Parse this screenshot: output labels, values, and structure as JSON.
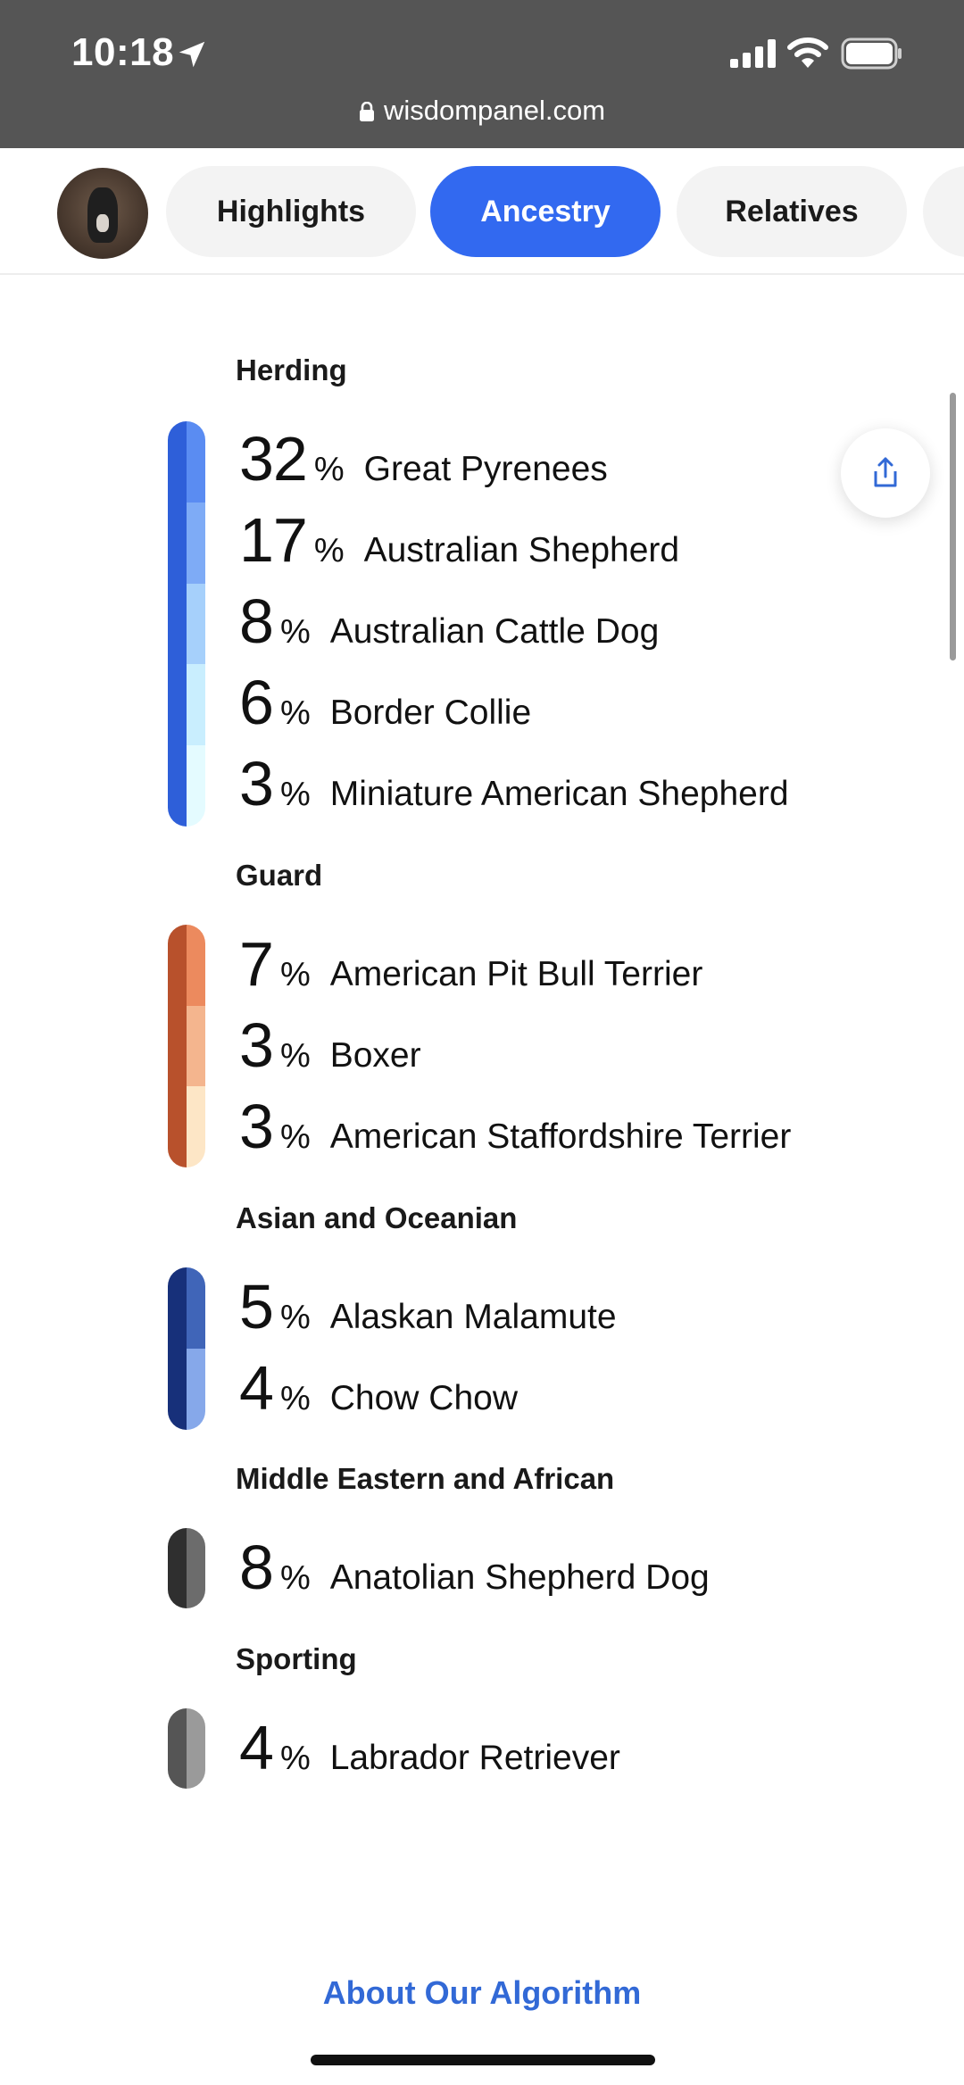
{
  "status_bar": {
    "time": "10:18",
    "url": "wisdompanel.com",
    "icons": [
      "location-arrow-icon",
      "signal-icon",
      "wifi-icon",
      "battery-icon",
      "lock-icon"
    ]
  },
  "nav": {
    "tabs": [
      {
        "label": "Highlights",
        "active": false
      },
      {
        "label": "Ancestry",
        "active": true
      },
      {
        "label": "Relatives",
        "active": false
      }
    ]
  },
  "groups": [
    {
      "title": "Herding",
      "colors": {
        "dark": "#2e5fd9",
        "segments": [
          "#5a8cf2",
          "#7eabf6",
          "#a6d0fb",
          "#c9eefe",
          "#e4fbff"
        ]
      },
      "breeds": [
        {
          "percent": "32",
          "name": "Great Pyrenees"
        },
        {
          "percent": "17",
          "name": "Australian Shepherd"
        },
        {
          "percent": "8",
          "name": "Australian Cattle Dog"
        },
        {
          "percent": "6",
          "name": "Border Collie"
        },
        {
          "percent": "3",
          "name": "Miniature American Shepherd"
        }
      ]
    },
    {
      "title": "Guard",
      "colors": {
        "dark": "#b8512c",
        "segments": [
          "#ec8a5e",
          "#f4b58e",
          "#fde6c6"
        ]
      },
      "breeds": [
        {
          "percent": "7",
          "name": "American Pit Bull Terrier"
        },
        {
          "percent": "3",
          "name": "Boxer"
        },
        {
          "percent": "3",
          "name": "American Staffordshire Terrier"
        }
      ]
    },
    {
      "title": "Asian and Oceanian",
      "colors": {
        "dark": "#17307a",
        "segments": [
          "#4065b8",
          "#86a8ea"
        ]
      },
      "breeds": [
        {
          "percent": "5",
          "name": "Alaskan Malamute"
        },
        {
          "percent": "4",
          "name": "Chow Chow"
        }
      ]
    },
    {
      "title": "Middle Eastern and African",
      "colors": {
        "dark": "#2f2f2f",
        "segments": [
          "#6c6c6c"
        ]
      },
      "breeds": [
        {
          "percent": "8",
          "name": "Anatolian Shepherd Dog"
        }
      ]
    },
    {
      "title": "Sporting",
      "colors": {
        "dark": "#555555",
        "segments": [
          "#9a9a9a"
        ]
      },
      "breeds": [
        {
          "percent": "4",
          "name": "Labrador Retriever"
        }
      ]
    }
  ],
  "percent_sign": "%",
  "footer": {
    "about_link": "About Our Algorithm"
  }
}
